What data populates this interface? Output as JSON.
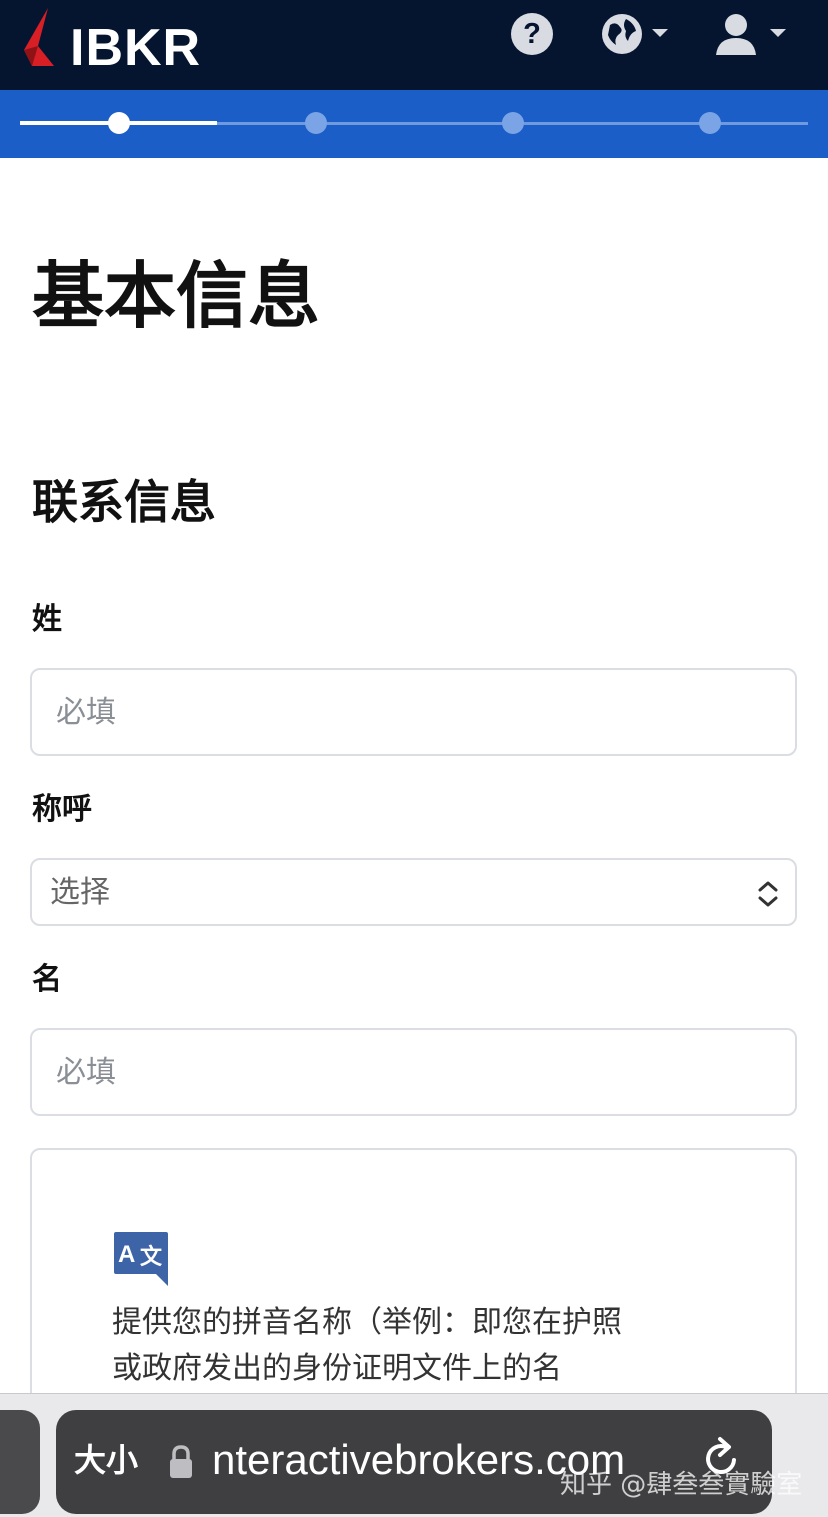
{
  "header": {
    "brand": "IBKR",
    "help_symbol": "?",
    "brand_color": "#051530",
    "logo_accent": "#d81f26"
  },
  "progress": {
    "total_steps": 4,
    "current_step": 1,
    "color": "#1c5ec7"
  },
  "page": {
    "title": "基本信息",
    "section_title": "联系信息"
  },
  "form": {
    "surname_label": "姓",
    "surname_placeholder": "必填",
    "salutation_label": "称呼",
    "salutation_value": "选择",
    "given_name_label": "名",
    "given_name_placeholder": "必填"
  },
  "info_card": {
    "icon": "translate-icon",
    "text_line1": "提供您的拼音名称（举例：即您在护照",
    "text_line2": "或政府发出的身份证明文件上的名"
  },
  "browser": {
    "text_size_label": "大小",
    "url": "nteractivebrokers.com",
    "watermark": "知乎 @肆叁叁實驗室"
  }
}
